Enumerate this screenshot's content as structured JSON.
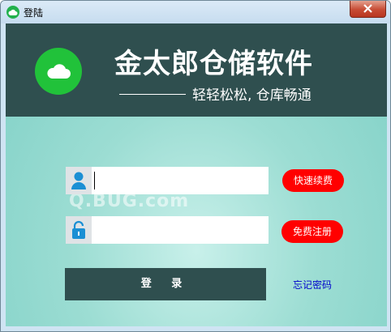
{
  "window": {
    "title": "登陆"
  },
  "header": {
    "app_title": "金太郎仓储软件",
    "slogan": "轻轻松松, 仓库畅通"
  },
  "username": {
    "value": "",
    "placeholder": ""
  },
  "password": {
    "value": "",
    "placeholder": ""
  },
  "buttons": {
    "quick_renew": "快速续费",
    "free_register": "免费注册",
    "login": "登 录",
    "forgot_password": "忘记密码"
  },
  "watermark": "Q.BUG.com",
  "colors": {
    "header_bg": "#2f4f4f",
    "accent_red": "#ff0000",
    "logo_green": "#21c23a",
    "link_blue": "#0000cc"
  },
  "icons": [
    "cloud-icon",
    "user-icon",
    "lock-icon",
    "close-icon"
  ]
}
